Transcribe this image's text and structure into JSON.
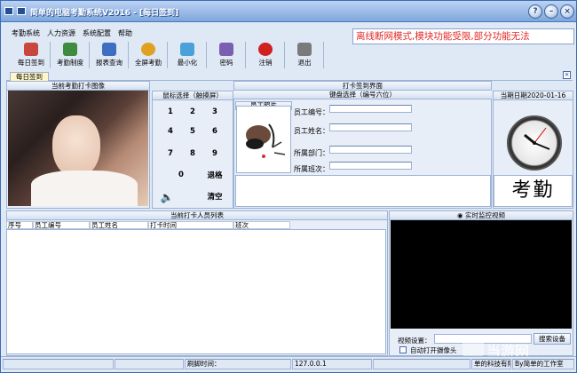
{
  "window": {
    "title": "简单的电脑考勤系统V2016 - [每日签到]",
    "buttons": {
      "help": "?",
      "minimize": "–",
      "close": "×"
    }
  },
  "menu": [
    "考勤系统",
    "人力资源",
    "系统配置",
    "帮助"
  ],
  "toolbar": [
    {
      "label": "每日签到",
      "icon": "calendar-icon",
      "color": "#c9463d"
    },
    {
      "label": "考勤制度",
      "icon": "rules-icon",
      "color": "#3f8b3f"
    },
    {
      "label": "报表查询",
      "icon": "report-icon",
      "color": "#3d6fc1"
    },
    {
      "label": "全屏考勤",
      "icon": "clock-icon",
      "color": "#e0a020"
    },
    {
      "label": "最小化",
      "icon": "minimize-icon",
      "color": "#4aa0d8"
    },
    {
      "label": "密码",
      "icon": "key-icon",
      "color": "#7a5fb0"
    },
    {
      "label": "注销",
      "icon": "stop-icon",
      "color": "#d02020"
    },
    {
      "label": "退出",
      "icon": "exit-icon",
      "color": "#7a7a7a"
    }
  ],
  "banner": "离线断网模式,模块功能受限,部分功能无法",
  "tab": {
    "label": "每日签到",
    "close": "×"
  },
  "photo_panel": {
    "title": "当前考勤打卡图像"
  },
  "mouse_panel": {
    "title": "鼠标选择（触摸屏）"
  },
  "keypad": {
    "keys": [
      "1",
      "2",
      "3",
      "4",
      "5",
      "6",
      "7",
      "8",
      "9",
      "0"
    ],
    "back": "退格",
    "clear": "清空"
  },
  "checkin_panel": {
    "title": "打卡签到界面",
    "keyboard": "键盘选择（编号六位）"
  },
  "employee": {
    "photo_label": "员工照片",
    "fields": [
      "员工编号：",
      "员工姓名：",
      "所属部门：",
      "所属班次："
    ]
  },
  "date_panel": {
    "label": "当期日期2020-01-16"
  },
  "kaoqin": "考勤",
  "list_panel": {
    "title": "当前打卡人员列表",
    "columns": [
      "序号",
      "员工编号",
      "员工姓名",
      "打卡时间",
      "班次"
    ]
  },
  "video_panel": {
    "title": "实时监控视频",
    "device_label": "视频设置：",
    "search_button": "搜索设备",
    "auto_open": "自动打开摄像头"
  },
  "status": {
    "time_label": "刷脚时间：",
    "ip": "127.0.0.1",
    "company": "单的科技有限公司",
    "by": "By简单的工作室"
  },
  "watermark": "当游网"
}
